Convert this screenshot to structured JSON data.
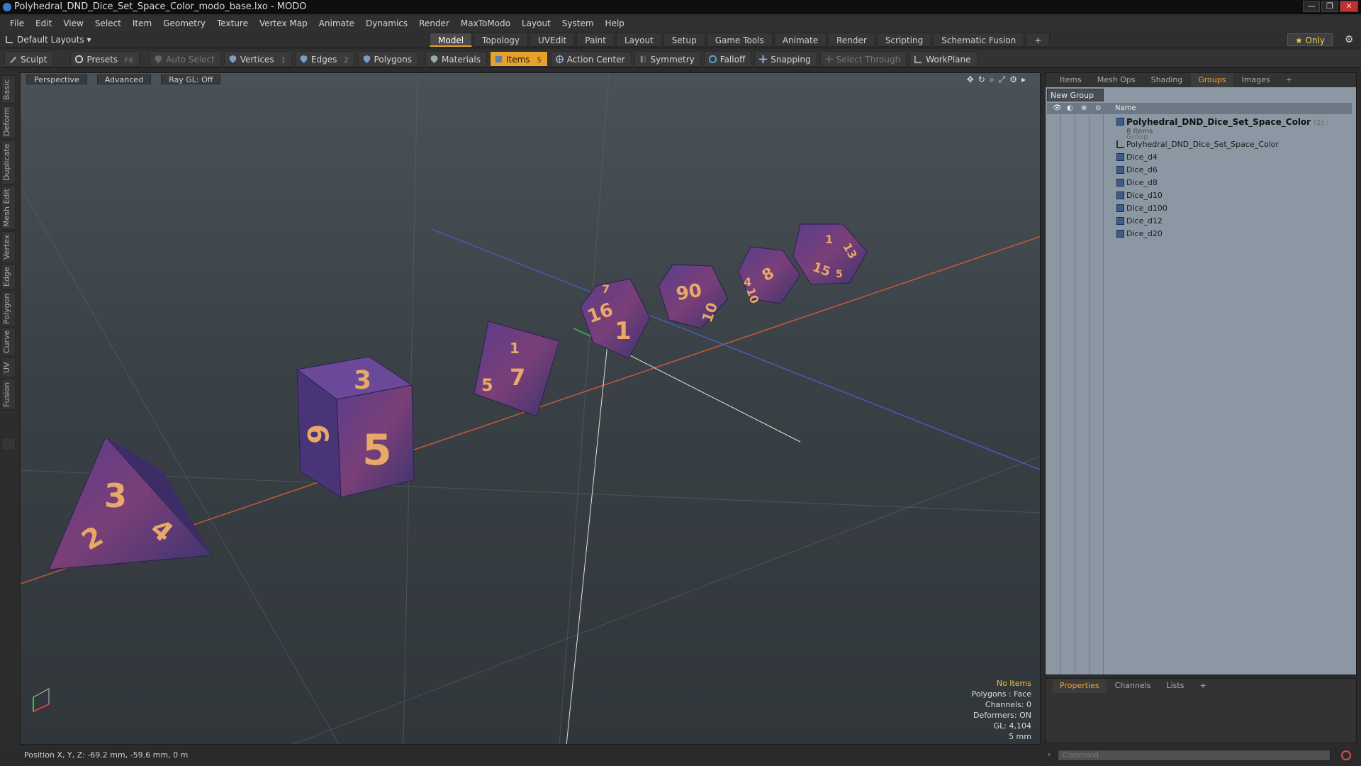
{
  "window": {
    "title": "Polyhedral_DND_Dice_Set_Space_Color_modo_base.lxo - MODO",
    "controls": [
      "—",
      "❐",
      "✕"
    ]
  },
  "menu": [
    "File",
    "Edit",
    "View",
    "Select",
    "Item",
    "Geometry",
    "Texture",
    "Vertex Map",
    "Animate",
    "Dynamics",
    "Render",
    "MaxToModo",
    "Layout",
    "System",
    "Help"
  ],
  "layoutbar": {
    "layout_selector": "Default Layouts ▾",
    "tabs": [
      "Model",
      "Topology",
      "UVEdit",
      "Paint",
      "Layout",
      "Setup",
      "Game Tools",
      "Animate",
      "Render",
      "Scripting",
      "Schematic Fusion",
      "+"
    ],
    "active_tab": "Model",
    "only_label": "★ Only"
  },
  "toolbar": {
    "sculpt": "Sculpt",
    "presets": "Presets",
    "presets_key": "F6",
    "auto_select": "Auto Select",
    "vertices": "Vertices",
    "vertices_count": "1",
    "edges": "Edges",
    "edges_count": "2",
    "polygons": "Polygons",
    "materials": "Materials",
    "items": "Items",
    "items_count": "5",
    "action_center": "Action Center",
    "symmetry": "Symmetry",
    "falloff": "Falloff",
    "snapping": "Snapping",
    "select_through": "Select Through",
    "workplane": "WorkPlane"
  },
  "left_tabs": [
    "Basic",
    "Deform",
    "Duplicate",
    "Mesh Edit",
    "Vertex",
    "Edge",
    "Polygon",
    "Curve",
    "UV",
    "Fusion"
  ],
  "viewport": {
    "view_mode": "Perspective",
    "shading": "Advanced",
    "raygl": "Ray GL: Off",
    "hud": {
      "selection": "No Items",
      "polygons": "Polygons : Face",
      "channels": "Channels: 0",
      "deformers": "Deformers: ON",
      "gl": "GL: 4,104",
      "grid": "5 mm"
    },
    "dice_labels": [
      "3",
      "2",
      "4",
      "3",
      "6",
      "5",
      "1",
      "5",
      "7",
      "7",
      "16",
      "1",
      "90",
      "10",
      "8",
      "4",
      "10",
      "1",
      "15",
      "13",
      "5"
    ]
  },
  "statusbar": {
    "position": "Position X, Y, Z:  -69.2 mm, -59.6 mm, 0 m"
  },
  "right_panel": {
    "tabs": [
      "Items",
      "Mesh Ops",
      "Shading",
      "Groups",
      "Images",
      "+"
    ],
    "active_tab": "Groups",
    "new_group": "New Group",
    "column_name": "Name",
    "group_name": "Polyhedral_DND_Dice_Set_Space_Color",
    "group_suffix": "(2) : Group",
    "group_count": "8 Items",
    "items": [
      "Polyhedral_DND_Dice_Set_Space_Color",
      "Dice_d4",
      "Dice_d6",
      "Dice_d8",
      "Dice_d10",
      "Dice_d100",
      "Dice_d12",
      "Dice_d20"
    ]
  },
  "props_panel": {
    "tabs": [
      "Properties",
      "Channels",
      "Lists",
      "+"
    ]
  },
  "command": {
    "placeholder": "Command"
  },
  "colors": {
    "accent": "#e8a12c",
    "dice_purple": "#5a3d8a",
    "dice_digits": "#e8a868"
  }
}
